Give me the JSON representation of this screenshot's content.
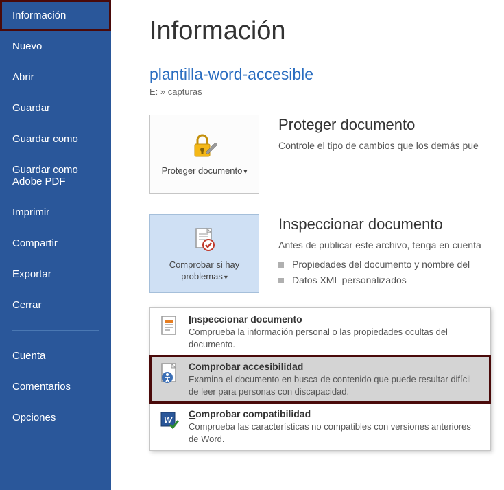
{
  "sidebar": {
    "items": [
      {
        "label": "Información"
      },
      {
        "label": "Nuevo"
      },
      {
        "label": "Abrir"
      },
      {
        "label": "Guardar"
      },
      {
        "label": "Guardar como"
      },
      {
        "label": "Guardar como Adobe PDF"
      },
      {
        "label": "Imprimir"
      },
      {
        "label": "Compartir"
      },
      {
        "label": "Exportar"
      },
      {
        "label": "Cerrar"
      }
    ],
    "bottom": [
      {
        "label": "Cuenta"
      },
      {
        "label": "Comentarios"
      },
      {
        "label": "Opciones"
      }
    ]
  },
  "main": {
    "title": "Información",
    "doc_title": "plantilla-word-accesible",
    "doc_path": "E: » capturas",
    "protect": {
      "tile_label": "Proteger documento",
      "heading": "Proteger documento",
      "desc": "Controle el tipo de cambios que los demás pue"
    },
    "inspect": {
      "tile_label": "Comprobar si hay problemas",
      "heading": "Inspeccionar documento",
      "desc": "Antes de publicar este archivo, tenga en cuenta",
      "bullets": [
        "Propiedades del documento y nombre del",
        "Datos XML personalizados"
      ]
    }
  },
  "menu": {
    "items": [
      {
        "title_pre": "",
        "title_ul": "I",
        "title_post": "nspeccionar documento",
        "desc": "Comprueba la información personal o las propiedades ocultas del documento."
      },
      {
        "title_pre": "Comprobar accesi",
        "title_ul": "b",
        "title_post": "ilidad",
        "desc": "Examina el documento en busca de contenido que puede resultar difícil de leer para personas con discapacidad."
      },
      {
        "title_pre": "",
        "title_ul": "C",
        "title_post": "omprobar compatibilidad",
        "desc": "Comprueba las características no compatibles con versiones anteriores de Word."
      }
    ]
  }
}
